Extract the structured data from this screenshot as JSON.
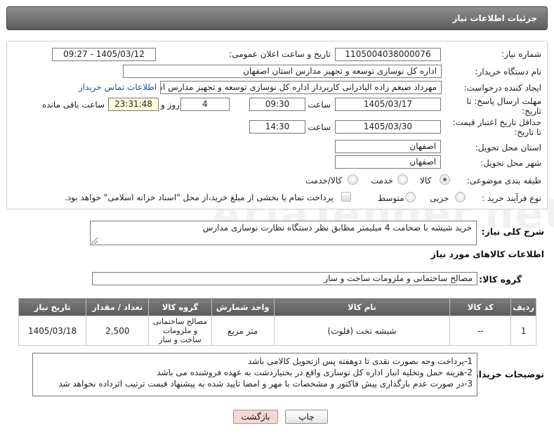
{
  "window": {
    "title": "جزئیات اطلاعات نیاز"
  },
  "form": {
    "need_number_label": "شماره نیاز:",
    "need_number": "1105004038000076",
    "announce_label": "تاریخ و ساعت اعلان عمومی:",
    "announce_value": "1405/03/12 - 09:27",
    "buyer_org_label": "نام دستگاه خریدار:",
    "buyer_org": "اداره کل نوسازی  توسعه و تجهیز مدارس استان اصفهان",
    "requester_label": "ایجاد کننده درخواست:",
    "requester": "مهرداد ضیغم زاده الیادرانی کارپرداز اداره کل نوسازی  توسعه و تجهیز مدارس استان اصفهان",
    "contact_link": "اطلاعات تماس خریدار",
    "deadline_label_1": "مهلت ارسال پاسخ: تا",
    "deadline_label_2": "تاریخ:",
    "deadline_date": "1405/03/17",
    "time_label": "ساعت",
    "deadline_time": "09:30",
    "days_value": "4",
    "days_label": "روز و",
    "remaining_value": "23:31:48",
    "remaining_label": "ساعت باقی مانده",
    "validity_label_1": "حداقل تاریخ اعتبار قیمت:",
    "validity_label_2": "تا تاریخ:",
    "validity_date": "1405/03/30",
    "validity_time": "14:30",
    "province_label": "استان محل تحویل:",
    "province": "اصفهان",
    "city_label": "شهر محل تحویل:",
    "city": "اصفهان",
    "category_label": "طبقه بندی موضوعی:",
    "category_options": [
      "کالا",
      "خدمت",
      "کالا/خدمت"
    ],
    "purchase_type_label": "نوع فرآیند خرید :",
    "purchase_options": [
      "جزیی",
      "متوسط"
    ],
    "payment_note": "پرداخت تمام یا بخشی از مبلغ خرید،از محل \"اسناد خزانه اسلامی\" خواهد بود."
  },
  "description": {
    "label": "شرح کلی نیاز:",
    "text": "خرید شیشه با ضخامت 4 میلیمتر مطابق نظر دستگاه نظارت نوسازی مدارس"
  },
  "goods_section_title": "اطلاعات کالاهای مورد نیاز",
  "goods_group": {
    "label": "گروه کالا:",
    "value": "مصالح ساختمانی و ملزومات ساخت و ساز"
  },
  "table": {
    "headers": [
      "ردیف",
      "کد کالا",
      "نام کالا",
      "واحد شمارش",
      "گروه کالا",
      "تعداد / مقدار",
      "تاریخ نیاز"
    ],
    "rows": [
      [
        "1",
        "--",
        "شیشه تخت (فلوت)",
        "متر مربع",
        "مصالح ساختمانی و ملزومات ساخت و ساز",
        "2,500",
        "1405/03/18"
      ]
    ]
  },
  "buyer_notes": {
    "label": "توضیحات خریدار:",
    "lines": [
      "1-پرداخت وجه بصورت نقدی تا دوهفته پس ازتحویل کالامی باشد",
      "2-هزینه حمل وتخلیه انبار اداره کل نوسازی واقع در بختیاردشت به عهده فروشنده می باشد",
      "3-در صورت عدم بارگذاری پیش فاکتور و مشخصات با مهر و امضا تایید شده به پیشنهاد قیمت ترتیب اثرداده نخواهد شد"
    ]
  },
  "buttons": {
    "print": "چاپ",
    "back": "بازگشت"
  },
  "watermark": "AriaTender.net"
}
